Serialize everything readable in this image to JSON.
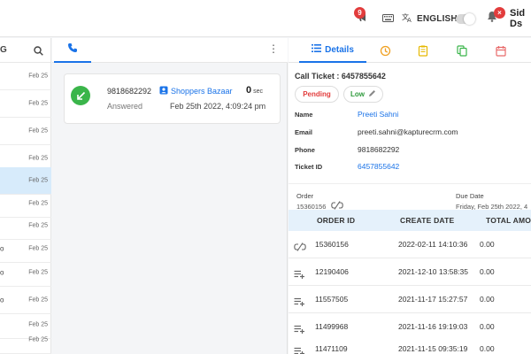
{
  "topbar": {
    "notification_count": "9",
    "language": "ENGLISH",
    "alert_badge": "×",
    "user_name": "Sid Ds"
  },
  "left_panel": {
    "header_partial": "G",
    "rows": [
      {
        "prefix": "",
        "date": "Feb 25"
      },
      {
        "prefix": "",
        "date": "Feb 25"
      },
      {
        "prefix": "",
        "date": "Feb 25"
      },
      {
        "prefix": "",
        "date": "Feb 25"
      },
      {
        "prefix": "",
        "date": "Feb 25"
      },
      {
        "prefix": "",
        "date": "Feb 25"
      },
      {
        "prefix": "",
        "date": "Feb 25"
      },
      {
        "prefix": "o",
        "date": "Feb 25"
      },
      {
        "prefix": "o",
        "date": "Feb 25"
      },
      {
        "prefix": "o",
        "date": "Feb 25"
      },
      {
        "prefix": "",
        "date": "Feb 25"
      },
      {
        "prefix": "",
        "date": "Feb 25"
      }
    ]
  },
  "call_card": {
    "phone": "9818682292",
    "contact": "Shoppers Bazaar",
    "duration": "0",
    "duration_unit": "sec",
    "status": "Answered",
    "datetime": "Feb 25th 2022, 4:09:24 pm"
  },
  "details": {
    "tab_label": "Details",
    "ticket_title": "Call Ticket : 6457855642",
    "status_pill": "Pending",
    "priority_pill": "Low",
    "fields": [
      {
        "label": "Name",
        "value": "Preeti Sahni",
        "link": true
      },
      {
        "label": "Email",
        "value": "preeti.sahni@kapturecrm.com",
        "link": false
      },
      {
        "label": "Phone",
        "value": "9818682292",
        "link": false
      },
      {
        "label": "Ticket ID",
        "value": "6457855642",
        "link": true
      }
    ],
    "order_label": "Order",
    "order_value": "15360156",
    "due_label": "Due Date",
    "due_value": "Friday, Feb 25th 2022, 4"
  },
  "orders_table": {
    "headers": [
      "ORDER ID",
      "CREATE DATE",
      "TOTAL AMO"
    ],
    "rows": [
      {
        "icon": "unlink-icon",
        "order_id": "15360156",
        "create_date": "2022-02-11 14:10:36",
        "total": "0.00"
      },
      {
        "icon": "add-to-list-icon",
        "order_id": "12190406",
        "create_date": "2021-12-10 13:58:35",
        "total": "0.00"
      },
      {
        "icon": "add-to-list-icon",
        "order_id": "11557505",
        "create_date": "2021-11-17 15:27:57",
        "total": "0.00"
      },
      {
        "icon": "add-to-list-icon",
        "order_id": "11499968",
        "create_date": "2021-11-16 19:19:03",
        "total": "0.00"
      },
      {
        "icon": "add-to-list-icon",
        "order_id": "11471109",
        "create_date": "2021-11-15 09:35:19",
        "total": "0.00"
      }
    ]
  },
  "colors": {
    "accent": "#1a73e8",
    "success": "#3ab54a",
    "danger": "#e23c3c",
    "table_header_bg": "#e5f1fb",
    "selected_row_bg": "#d7ebfb"
  }
}
